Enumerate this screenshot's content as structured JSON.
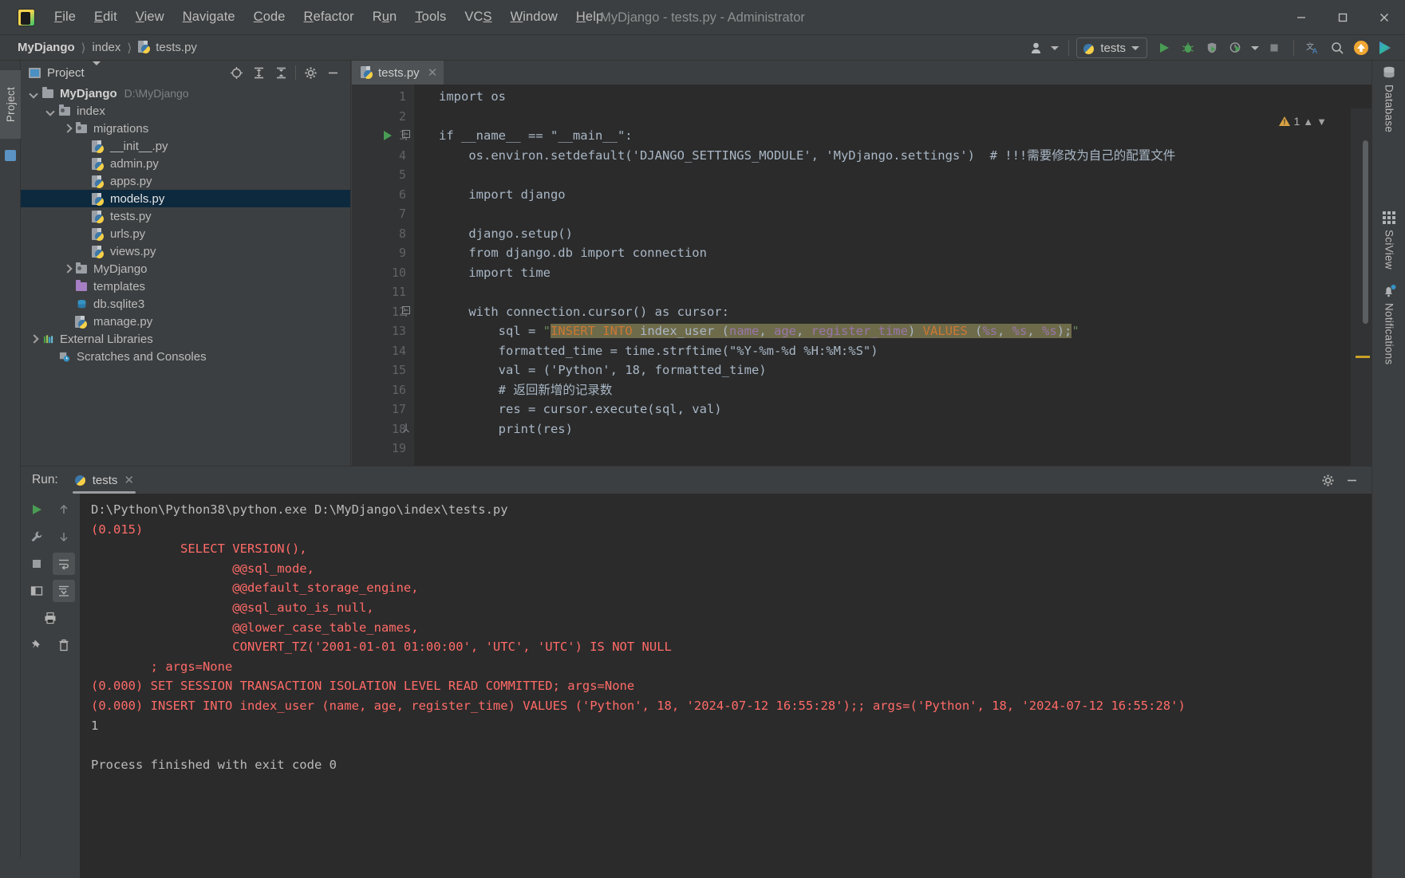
{
  "window": {
    "title": "MyDjango - tests.py - Administrator",
    "minimize": "minimize-icon",
    "maximize": "maximize-icon",
    "close": "close-icon"
  },
  "menubar": {
    "items": [
      {
        "label": "File",
        "mnemonic": "F"
      },
      {
        "label": "Edit",
        "mnemonic": "E"
      },
      {
        "label": "View",
        "mnemonic": "V"
      },
      {
        "label": "Navigate",
        "mnemonic": "N"
      },
      {
        "label": "Code",
        "mnemonic": "C"
      },
      {
        "label": "Refactor",
        "mnemonic": "R"
      },
      {
        "label": "Run",
        "mnemonic": "u"
      },
      {
        "label": "Tools",
        "mnemonic": "T"
      },
      {
        "label": "VCS",
        "mnemonic": "S"
      },
      {
        "label": "Window",
        "mnemonic": "W"
      },
      {
        "label": "Help",
        "mnemonic": "H"
      }
    ]
  },
  "breadcrumb": {
    "items": [
      "MyDjango",
      "index",
      "tests.py"
    ],
    "separator": "〉"
  },
  "toolbar": {
    "run_config_label": "tests",
    "buttons": [
      "user-avatar-dropdown",
      "run-button",
      "debug-button",
      "run-coverage-button",
      "profile-button",
      "stop-button",
      "translate-button",
      "search-everywhere-button",
      "update-button",
      "ide-feature-button"
    ]
  },
  "left_stripe": {
    "project_label": "Project"
  },
  "project_panel": {
    "header_label": "Project",
    "header_buttons": [
      "locate-icon",
      "expand-all-icon",
      "collapse-all-icon",
      "gear-icon",
      "hide-icon"
    ],
    "tree": [
      {
        "label": "MyDjango",
        "path": "D:\\MyDjango",
        "indent": 0,
        "arrow": "down",
        "icon": "folder",
        "bold": true,
        "selected": false
      },
      {
        "label": "index",
        "path": "",
        "indent": 1,
        "arrow": "down",
        "icon": "folder-module",
        "bold": false,
        "selected": false
      },
      {
        "label": "migrations",
        "path": "",
        "indent": 2,
        "arrow": "right",
        "icon": "folder-module",
        "bold": false,
        "selected": false
      },
      {
        "label": "__init__.py",
        "path": "",
        "indent": 3,
        "arrow": "none",
        "icon": "py-file",
        "bold": false,
        "selected": false
      },
      {
        "label": "admin.py",
        "path": "",
        "indent": 3,
        "arrow": "none",
        "icon": "py-file",
        "bold": false,
        "selected": false
      },
      {
        "label": "apps.py",
        "path": "",
        "indent": 3,
        "arrow": "none",
        "icon": "py-file",
        "bold": false,
        "selected": false
      },
      {
        "label": "models.py",
        "path": "",
        "indent": 3,
        "arrow": "none",
        "icon": "py-file",
        "bold": false,
        "selected": true
      },
      {
        "label": "tests.py",
        "path": "",
        "indent": 3,
        "arrow": "none",
        "icon": "py-file",
        "bold": false,
        "selected": false
      },
      {
        "label": "urls.py",
        "path": "",
        "indent": 3,
        "arrow": "none",
        "icon": "py-file",
        "bold": false,
        "selected": false
      },
      {
        "label": "views.py",
        "path": "",
        "indent": 3,
        "arrow": "none",
        "icon": "py-file",
        "bold": false,
        "selected": false
      },
      {
        "label": "MyDjango",
        "path": "",
        "indent": 2,
        "arrow": "right",
        "icon": "folder-module",
        "bold": false,
        "selected": false
      },
      {
        "label": "templates",
        "path": "",
        "indent": 2,
        "arrow": "none",
        "icon": "folder-purple",
        "bold": false,
        "selected": false
      },
      {
        "label": "db.sqlite3",
        "path": "",
        "indent": 2,
        "arrow": "none",
        "icon": "database-file",
        "bold": false,
        "selected": false
      },
      {
        "label": "manage.py",
        "path": "",
        "indent": 2,
        "arrow": "none",
        "icon": "py-file",
        "bold": false,
        "selected": false
      },
      {
        "label": "External Libraries",
        "path": "",
        "indent": 0,
        "arrow": "right",
        "icon": "libraries",
        "bold": false,
        "selected": false
      },
      {
        "label": "Scratches and Consoles",
        "path": "",
        "indent": 1,
        "arrow": "none",
        "icon": "scratches",
        "bold": false,
        "selected": false
      }
    ]
  },
  "editor": {
    "tab_label": "tests.py",
    "tab_close": "close-icon",
    "warning_count": "1",
    "lines": [
      {
        "n": "1",
        "runmark": false,
        "fold": "",
        "text": "import os"
      },
      {
        "n": "2",
        "runmark": false,
        "fold": "",
        "text": ""
      },
      {
        "n": "3",
        "runmark": true,
        "fold": "start",
        "text": "if __name__ == \"__main__\":"
      },
      {
        "n": "4",
        "runmark": false,
        "fold": "",
        "text": "    os.environ.setdefault('DJANGO_SETTINGS_MODULE', 'MyDjango.settings')  # !!!需要修改为自己的配置文件"
      },
      {
        "n": "5",
        "runmark": false,
        "fold": "",
        "text": ""
      },
      {
        "n": "6",
        "runmark": false,
        "fold": "",
        "text": "    import django"
      },
      {
        "n": "7",
        "runmark": false,
        "fold": "",
        "text": ""
      },
      {
        "n": "8",
        "runmark": false,
        "fold": "",
        "text": "    django.setup()"
      },
      {
        "n": "9",
        "runmark": false,
        "fold": "",
        "text": "    from django.db import connection"
      },
      {
        "n": "10",
        "runmark": false,
        "fold": "",
        "text": "    import time"
      },
      {
        "n": "11",
        "runmark": false,
        "fold": "",
        "text": ""
      },
      {
        "n": "12",
        "runmark": false,
        "fold": "start",
        "text": "    with connection.cursor() as cursor:"
      },
      {
        "n": "13",
        "runmark": false,
        "fold": "",
        "text": "        sql = \"INSERT INTO index_user (name, age, register_time) VALUES (%s, %s, %s);\""
      },
      {
        "n": "14",
        "runmark": false,
        "fold": "",
        "text": "        formatted_time = time.strftime(\"%Y-%m-%d %H:%M:%S\")"
      },
      {
        "n": "15",
        "runmark": false,
        "fold": "",
        "text": "        val = ('Python', 18, formatted_time)"
      },
      {
        "n": "16",
        "runmark": false,
        "fold": "",
        "text": "        # 返回新增的记录数"
      },
      {
        "n": "17",
        "runmark": false,
        "fold": "",
        "text": "        res = cursor.execute(sql, val)"
      },
      {
        "n": "18",
        "runmark": false,
        "fold": "end",
        "text": "        print(res)"
      },
      {
        "n": "19",
        "runmark": false,
        "fold": "",
        "text": ""
      }
    ]
  },
  "right_stripe": {
    "items": [
      {
        "label": "Database",
        "icon": "database-icon"
      },
      {
        "label": "SciView",
        "icon": "grid-icon"
      },
      {
        "label": "Notifications",
        "icon": "bell-icon"
      }
    ]
  },
  "run_panel": {
    "label": "Run:",
    "tab_label": "tests",
    "tab_close": "close-icon",
    "header_buttons": [
      "gear-icon",
      "hide-icon"
    ],
    "side_buttons": [
      "rerun-icon",
      "up-arrow-icon",
      "wrench-icon",
      "down-arrow-icon",
      "stop-icon",
      "soft-wrap-icon",
      "layout-icon",
      "scroll-to-end-icon",
      "print-icon",
      "pin-icon",
      "trash-icon"
    ],
    "console_lines": [
      {
        "text": "D:\\Python\\Python38\\python.exe D:\\MyDjango\\index\\tests.py",
        "color": "white"
      },
      {
        "text": "(0.015)",
        "color": "red"
      },
      {
        "text": "            SELECT VERSION(),",
        "color": "red"
      },
      {
        "text": "                   @@sql_mode,",
        "color": "red"
      },
      {
        "text": "                   @@default_storage_engine,",
        "color": "red"
      },
      {
        "text": "                   @@sql_auto_is_null,",
        "color": "red"
      },
      {
        "text": "                   @@lower_case_table_names,",
        "color": "red"
      },
      {
        "text": "                   CONVERT_TZ('2001-01-01 01:00:00', 'UTC', 'UTC') IS NOT NULL",
        "color": "red"
      },
      {
        "text": "        ; args=None",
        "color": "red"
      },
      {
        "text": "(0.000) SET SESSION TRANSACTION ISOLATION LEVEL READ COMMITTED; args=None",
        "color": "red"
      },
      {
        "text": "(0.000) INSERT INTO index_user (name, age, register_time) VALUES ('Python', 18, '2024-07-12 16:55:28');; args=('Python', 18, '2024-07-12 16:55:28')",
        "color": "red"
      },
      {
        "text": "1",
        "color": "white"
      },
      {
        "text": "",
        "color": "white"
      },
      {
        "text": "Process finished with exit code 0",
        "color": "white"
      }
    ]
  },
  "colors": {
    "chrome": "#3c3f41",
    "editor_bg": "#2b2b2b",
    "selection": "#0d293e",
    "accent_green": "#499c54",
    "keyword": "#cc7832",
    "string": "#6a8759",
    "number": "#6897bb",
    "comment": "#808080",
    "sql_highlight": "#6e6b4a",
    "console_red": "#ff6b68"
  }
}
